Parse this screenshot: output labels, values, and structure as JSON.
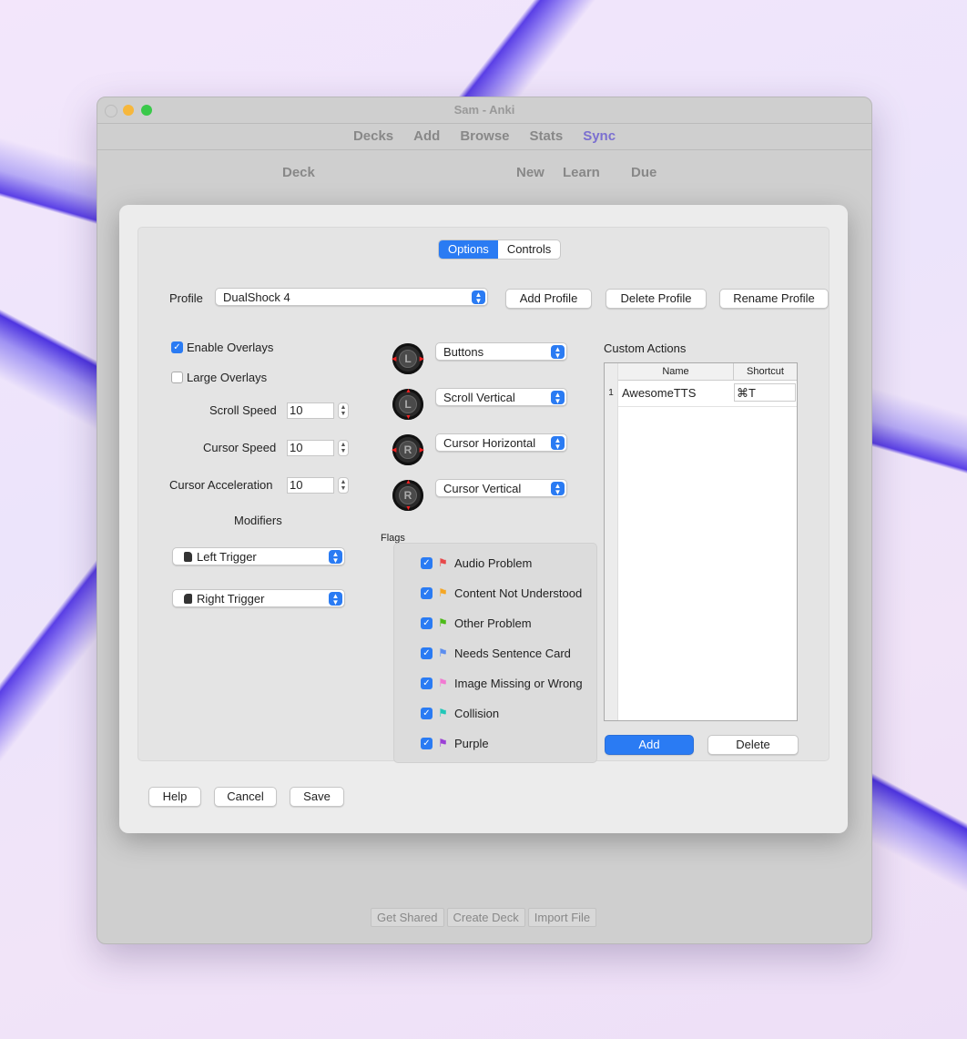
{
  "window": {
    "title": "Sam - Anki"
  },
  "toolbar": {
    "decks": "Decks",
    "add": "Add",
    "browse": "Browse",
    "stats": "Stats",
    "sync": "Sync"
  },
  "deck_header": {
    "deck": "Deck",
    "new": "New",
    "learn": "Learn",
    "due": "Due"
  },
  "bottom_buttons": {
    "get_shared": "Get Shared",
    "create_deck": "Create Deck",
    "import_file": "Import File"
  },
  "dialog": {
    "tabs": [
      {
        "label": "Options",
        "active": true
      },
      {
        "label": "Controls",
        "active": false
      }
    ],
    "profile": {
      "label": "Profile",
      "selected": "DualShock 4",
      "add": "Add Profile",
      "delete": "Delete Profile",
      "rename": "Rename Profile"
    },
    "options": {
      "enable_overlays": {
        "label": "Enable Overlays",
        "checked": true
      },
      "large_overlays": {
        "label": "Large Overlays",
        "checked": false
      },
      "scroll_speed": {
        "label": "Scroll Speed",
        "value": "10"
      },
      "cursor_speed": {
        "label": "Cursor Speed",
        "value": "10"
      },
      "cursor_acceleration": {
        "label": "Cursor Acceleration",
        "value": "10"
      },
      "modifiers_title": "Modifiers",
      "modifiers": [
        "Left Trigger",
        "Right Trigger"
      ]
    },
    "sticks": [
      {
        "letter": "L",
        "mode": "Buttons"
      },
      {
        "letter": "L",
        "mode": "Scroll Vertical"
      },
      {
        "letter": "R",
        "mode": "Cursor Horizontal"
      },
      {
        "letter": "R",
        "mode": "Cursor Vertical"
      }
    ],
    "flags": {
      "title": "Flags",
      "items": [
        {
          "label": "Audio Problem",
          "color": "#e8484a",
          "checked": true
        },
        {
          "label": "Content Not Understood",
          "color": "#f5a623",
          "checked": true
        },
        {
          "label": "Other Problem",
          "color": "#4cbb17",
          "checked": true
        },
        {
          "label": "Needs Sentence Card",
          "color": "#5b8def",
          "checked": true
        },
        {
          "label": "Image Missing or Wrong",
          "color": "#f279d2",
          "checked": true
        },
        {
          "label": "Collision",
          "color": "#20c7b8",
          "checked": true
        },
        {
          "label": "Purple",
          "color": "#9b3fd6",
          "checked": true
        }
      ]
    },
    "custom_actions": {
      "title": "Custom Actions",
      "columns": [
        "Name",
        "Shortcut"
      ],
      "rows": [
        {
          "index": "1",
          "name": "AwesomeTTS",
          "shortcut": "⌘T"
        }
      ],
      "add": "Add",
      "delete": "Delete"
    },
    "footer": {
      "help": "Help",
      "cancel": "Cancel",
      "save": "Save"
    }
  },
  "colors": {
    "accent": "#2a7bf3",
    "sync": "#7b6fd0"
  }
}
